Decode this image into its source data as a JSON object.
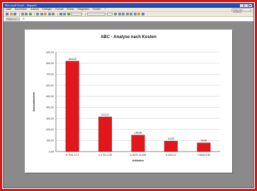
{
  "window": {
    "title": "Microsoft Excel - Mappe1",
    "menu": [
      "Datei",
      "Bearbeiten",
      "Ansicht",
      "Einfügen",
      "Format",
      "Extras",
      "Diagramm",
      "Fenster",
      "?"
    ],
    "help_placeholder": "Frage hier eingeben"
  },
  "formula": {
    "namebox": "Diagramm 1",
    "fx": "fx"
  },
  "colors": {
    "frame": "#d01818",
    "bar": "#e0181c",
    "workarea": "#8a8a8a"
  },
  "chart_data": {
    "type": "bar",
    "title": "ABC - Analyse nach Kosten",
    "xlabel": "Artikelnr",
    "ylabel": "Gesamtkosten",
    "categories": [
      "5-7501-12,2",
      "5-1761-3,35",
      "5-0479-16,295",
      "4-4001-5",
      "7-5006-5,60"
    ],
    "values": [
      818.28,
      313.21,
      148.85,
      94.55,
      78.45
    ],
    "value_labels": [
      "818,28",
      "313,21",
      "148,85",
      "94,55",
      "78,45"
    ],
    "ylim": [
      0,
      900
    ],
    "yticks": [
      "0,00",
      "100,00",
      "200,00",
      "300,00",
      "400,00",
      "500,00",
      "600,00",
      "700,00",
      "800,00",
      "900,00"
    ],
    "grid": true,
    "legend": "none"
  }
}
